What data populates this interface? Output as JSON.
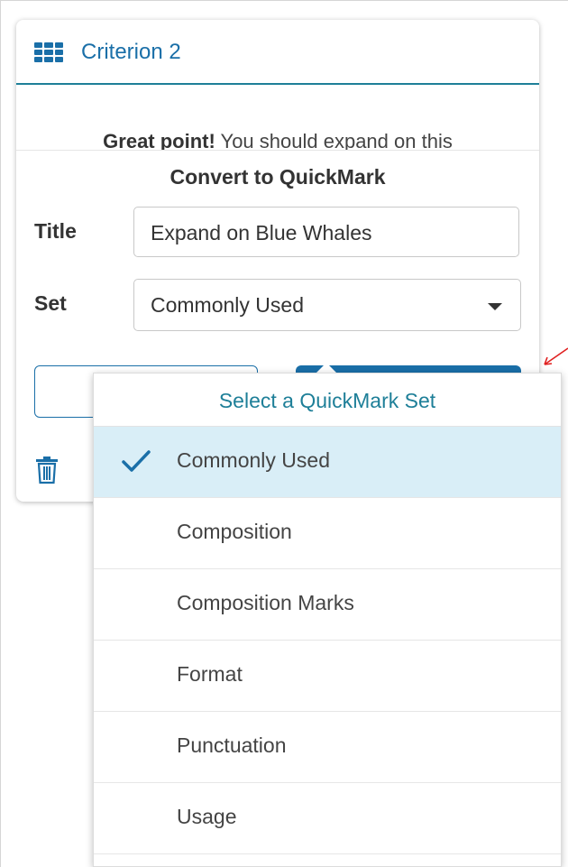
{
  "card": {
    "title": "Criterion 2",
    "comment_bold": "Great point!",
    "comment_rest": " You should expand on this"
  },
  "convert": {
    "title": "Convert to QuickMark",
    "title_label": "Title",
    "title_value": "Expand on Blue Whales",
    "set_label": "Set",
    "set_value": "Commonly Used"
  },
  "dropdown": {
    "header": "Select a QuickMark Set",
    "selected": "Commonly Used",
    "items": [
      {
        "label": "Commonly Used"
      },
      {
        "label": "Composition"
      },
      {
        "label": "Composition Marks"
      },
      {
        "label": "Format"
      },
      {
        "label": "Punctuation"
      },
      {
        "label": "Usage"
      }
    ]
  },
  "colors": {
    "accent": "#1a6fa8",
    "header_rule": "#1e7f98",
    "selected_bg": "#d9eef7",
    "annotation": "#e02020"
  },
  "icons": {
    "header": "grid-icon",
    "delete": "trash-icon",
    "selected": "checkmark-icon",
    "select_caret": "caret-down-icon"
  }
}
